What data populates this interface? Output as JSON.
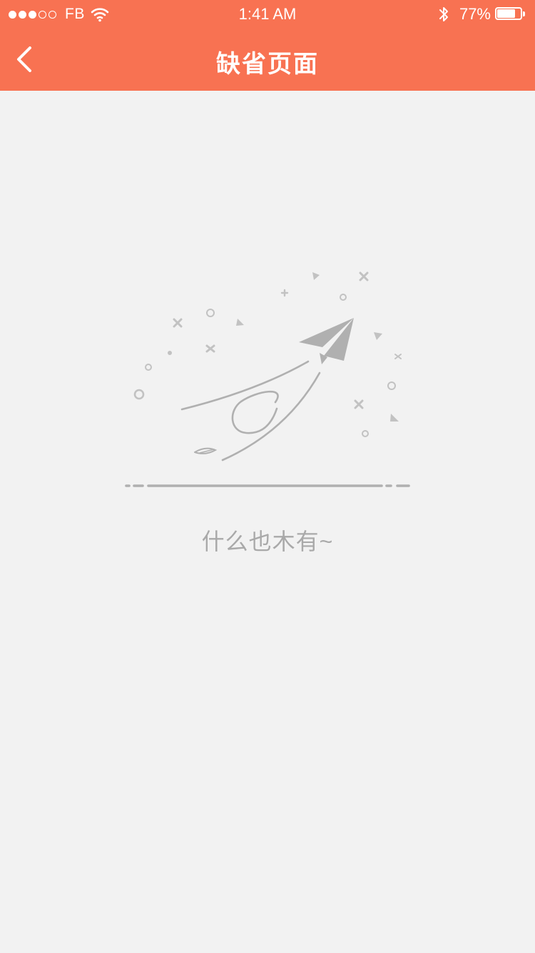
{
  "status_bar": {
    "signal_bars_filled": 3,
    "signal_bars_total": 5,
    "carrier": "FB",
    "time": "1:41 AM",
    "battery_percent_label": "77%",
    "battery_level": 0.77
  },
  "nav": {
    "title": "缺省页面",
    "back_icon": "chevron-left-icon"
  },
  "empty_state": {
    "illustration": "paper-plane-illustration",
    "message": "什么也木有~"
  },
  "colors": {
    "header_bg": "#f87252",
    "page_bg": "#f2f2f2",
    "illustration_gray": "#b0b0b0",
    "message_gray": "#a9a9a9"
  }
}
